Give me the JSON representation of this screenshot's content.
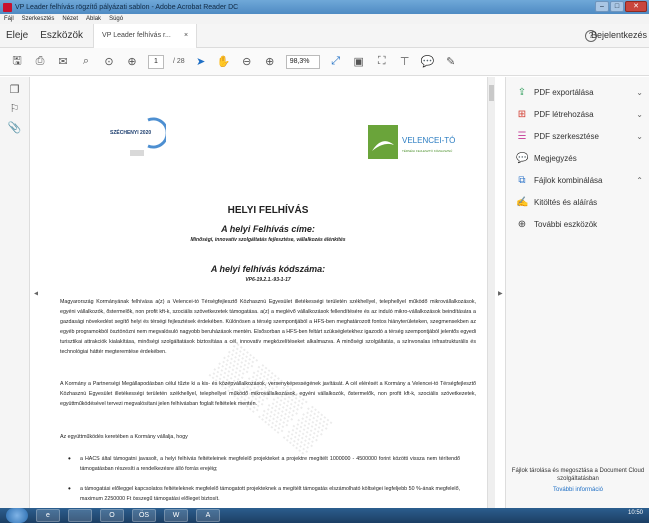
{
  "window": {
    "title": "VP Leader felhívás rögzítő pályázati sablon - Adobe Acrobat Reader DC"
  },
  "menu": [
    "Fájl",
    "Szerkesztés",
    "Nézet",
    "Ablak",
    "Súgó"
  ],
  "tabs": {
    "home": "Eleje",
    "tools": "Eszközök",
    "doc_tab": "VP Leader felhívás r...",
    "close": "×"
  },
  "header": {
    "help": "?",
    "login": "Bejelentkezés"
  },
  "toolbar": {
    "page_current": "1",
    "page_total": "/ 28",
    "zoom": "98,3%"
  },
  "right_panel": {
    "items": [
      {
        "label": "PDF exportálása",
        "icon": "pdf-export-icon",
        "chev": "⌄"
      },
      {
        "label": "PDF létrehozása",
        "icon": "pdf-create-icon",
        "chev": "⌄"
      },
      {
        "label": "PDF szerkesztése",
        "icon": "pdf-edit-icon",
        "chev": "⌄"
      },
      {
        "label": "Megjegyzés",
        "icon": "comment-icon",
        "chev": ""
      },
      {
        "label": "Fájlok kombinálása",
        "icon": "combine-icon",
        "chev": "⌃"
      },
      {
        "label": "Kitöltés és aláírás",
        "icon": "sign-icon",
        "chev": ""
      },
      {
        "label": "További eszközök",
        "icon": "more-tools-icon",
        "chev": ""
      }
    ],
    "footer_text": "Fájlok tárolása és megosztása a Document Cloud szolgáltatásban",
    "footer_link": "További információ"
  },
  "document": {
    "logo_left": "SZÉCHENYI 2020",
    "logo_right": "VELENCEI-TÓ",
    "logo_right_sub": "TÉRSÉGI FEJLESZTŐ KÖZHASZNÚ",
    "title": "HELYI FELHÍVÁS",
    "subtitle": "A helyi Felhívás címe:",
    "subtitle_detail": "Minőségi, innovatív szolgáltatás fejlesztése, vállalkozás élénkítés",
    "code_title": "A helyi felhívás kódszáma:",
    "code": "VP6-19.2.1.-93-1-17",
    "para1": "Magyarország Kormányának felhívása a(z) a Velencei-tó Térségfejlesztő Közhasznú Egyesület illetékességi területén székhellyel, telephellyel működő mikrovállalkozások, egyéni vállalkozók, őstermelők, non profit kft-k, szociális szövetkezetek támogatása. a(z) a meglévő vállalkozások fellendítésére és az induló mikro-vállalkozások beindítására a gazdasági növekedést segítő helyi és térségi fejlesztések érdekében. Különösen a térség szempontjából a HFS-ben meghatározott fontos hiányterületeken, szegmensekben az egyéb programokból ösztönözni nem megvalósuló nagyobb beruházások mentén. Elsősorban a HFS-ben feltárt szükségletekhez igazodó a térség szempontjából jelentős egyedi turisztikai attrakciók kialakítása, minőségi szolgáltatások biztosítása a cél, innovatív megközelítéseket alkalmazva. A minőségi szolgáltatás, a színvonalas infrastrukturális és technológiai háttér megteremtése érdekében.",
    "para2": "A Kormány a Partnerségi Megállapodásban célul tűzte ki a kis- és középvállalkozások, versenyképességének javítását. A cél elérését a Kormány a Velencei-tó Térségfejlesztő Közhasznú Egyesület illetékességi területén székhellyel, telephellyel működő mikrovállalkozások, egyéni vállalkozók, őstermelők, non profit kft-k, szociális szövetkezetek, együttműködésével tervezi megvalósítani jelen felhívásban foglalt feltételek mentén.",
    "para3": "Az együttműködés keretében a Kormány vállalja, hogy",
    "bullet1": "a HACS által támogatni javasolt, a helyi felhívás feltételeinek megfelelő projekteket a projektre megítélt 1000000 - 4500000 forint közötti vissza nem térítendő támogatásban részesíti a rendelkezésre álló forrás erejéig;",
    "bullet2": "a támogatási előleggel kapcsolatos feltételeknek megfelelő támogatott projekteknek a megítélt támogatás elszámolható költségei legfeljebb 50 %-ának megfelelő, maximum 2250000 Ft összegű támogatási előleget biztosít."
  },
  "taskbar": {
    "apps": [
      "e",
      "",
      "O",
      "ÖS",
      "W",
      "A"
    ],
    "clock": "10:50"
  }
}
